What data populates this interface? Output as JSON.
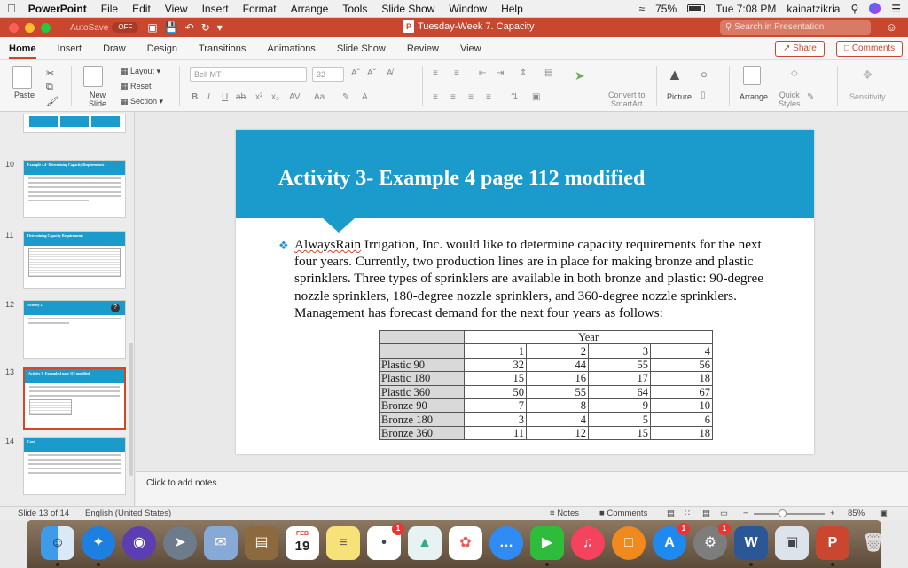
{
  "menubar": {
    "app": "PowerPoint",
    "items": [
      "File",
      "Edit",
      "View",
      "Insert",
      "Format",
      "Arrange",
      "Tools",
      "Slide Show",
      "Window",
      "Help"
    ],
    "battery": "75%",
    "clock": "Tue 7:08 PM",
    "user": "kainatzikria"
  },
  "titlebar": {
    "autosave_label": "AutoSave",
    "autosave_state": "OFF",
    "doc_title": "Tuesday-Week 7. Capacity",
    "search_placeholder": "Search in Presentation"
  },
  "tabs": {
    "items": [
      "Home",
      "Insert",
      "Draw",
      "Design",
      "Transitions",
      "Animations",
      "Slide Show",
      "Review",
      "View"
    ],
    "share": "Share",
    "comments": "Comments"
  },
  "ribbon": {
    "paste": "Paste",
    "new_slide": "New\nSlide",
    "layout": "Layout",
    "reset": "Reset",
    "section": "Section",
    "font_name": "Bell MT",
    "font_size": "32",
    "convert_to_smartart": "Convert to\nSmartArt",
    "picture": "Picture",
    "arrange": "Arrange",
    "quick_styles": "Quick\nStyles",
    "sensitivity": "Sensitivity"
  },
  "thumbnails": [
    {
      "num": "10",
      "title": "Example 4.4- Determining Capacity Requirements"
    },
    {
      "num": "11",
      "title": "Determining Capacity Requirements"
    },
    {
      "num": "12",
      "title": "Activity 2"
    },
    {
      "num": "13",
      "title": "Activity 3- Example 4 page 112 modified"
    },
    {
      "num": "14",
      "title": "Cost"
    }
  ],
  "slide": {
    "title": "Activity 3- Example 4 page 112 modified",
    "company": "AlwaysRain",
    "body_rest": " Irrigation, Inc. would like to determine capacity requirements for the next four years. Currently, two production lines are in place for making bronze and plastic sprinklers. Three types of sprinklers are available in both bronze and plastic: 90-degree nozzle sprinklers, 180-degree nozzle sprinklers, and 360-degree nozzle sprinklers. Management has forecast demand for the next four years as follows:",
    "table": {
      "group_header": "Year",
      "years": [
        "1",
        "2",
        "3",
        "4"
      ],
      "rows": [
        {
          "label": "Plastic 90",
          "values": [
            "32",
            "44",
            "55",
            "56"
          ]
        },
        {
          "label": "Plastic 180",
          "values": [
            "15",
            "16",
            "17",
            "18"
          ]
        },
        {
          "label": "Plastic 360",
          "values": [
            "50",
            "55",
            "64",
            "67"
          ]
        },
        {
          "label": "Bronze 90",
          "values": [
            "7",
            "8",
            "9",
            "10"
          ]
        },
        {
          "label": "Bronze 180",
          "values": [
            "3",
            "4",
            "5",
            "6"
          ]
        },
        {
          "label": "Bronze 360",
          "values": [
            "11",
            "12",
            "15",
            "18"
          ]
        }
      ]
    }
  },
  "notes": "Click to add notes",
  "status": {
    "slide_info": "Slide 13 of 14",
    "language": "English (United States)",
    "notes": "Notes",
    "comments": "Comments",
    "zoom": "85%"
  },
  "dock": {
    "calendar_month": "FEB",
    "calendar_day": "19"
  }
}
